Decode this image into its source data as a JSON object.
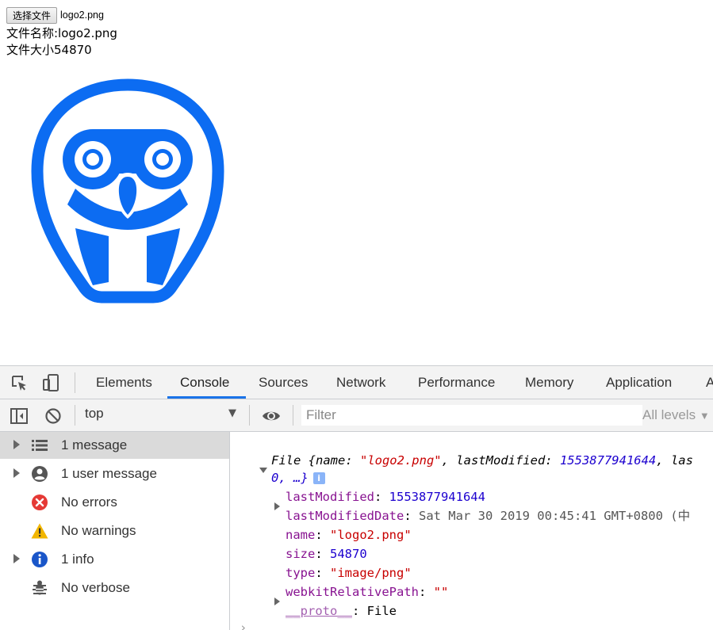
{
  "page": {
    "choose_button": "选择文件",
    "chosen_file": "logo2.png",
    "name_line": "文件名称:logo2.png",
    "size_line": "文件大小54870",
    "owl_color": "#0c6cf2"
  },
  "devtools": {
    "tabs": [
      "Elements",
      "Console",
      "Sources",
      "Network",
      "Performance",
      "Memory",
      "Application",
      "A"
    ],
    "active_tab": "Console",
    "context": "top",
    "filter_placeholder": "Filter",
    "levels": "All levels",
    "sidebar": [
      {
        "label": "1 message",
        "icon": "list-icon"
      },
      {
        "label": "1 user message",
        "icon": "user-icon"
      },
      {
        "label": "No errors",
        "icon": "error-icon"
      },
      {
        "label": "No warnings",
        "icon": "warning-icon"
      },
      {
        "label": "1 info",
        "icon": "info-icon"
      },
      {
        "label": "No verbose",
        "icon": "bug-icon"
      }
    ],
    "console": {
      "summary_prefix": "File {name: ",
      "summary_name": "\"logo2.png\"",
      "summary_mid": ", lastModified: ",
      "summary_lm": "1553877941644",
      "summary_tail": ", las",
      "summary_line2": "0, …}",
      "info_badge": "i",
      "props": [
        {
          "key": "lastModified",
          "value": "1553877941644"
        },
        {
          "key": "lastModifiedDate",
          "value": "Sat Mar 30 2019 00:45:41 GMT+0800 (中"
        },
        {
          "key": "name",
          "value": "\"logo2.png\""
        },
        {
          "key": "size",
          "value": "54870"
        },
        {
          "key": "type",
          "value": "\"image/png\""
        },
        {
          "key": "webkitRelativePath",
          "value": "\"\""
        },
        {
          "key": "__proto__",
          "value": "File"
        }
      ],
      "colon": ": "
    }
  }
}
